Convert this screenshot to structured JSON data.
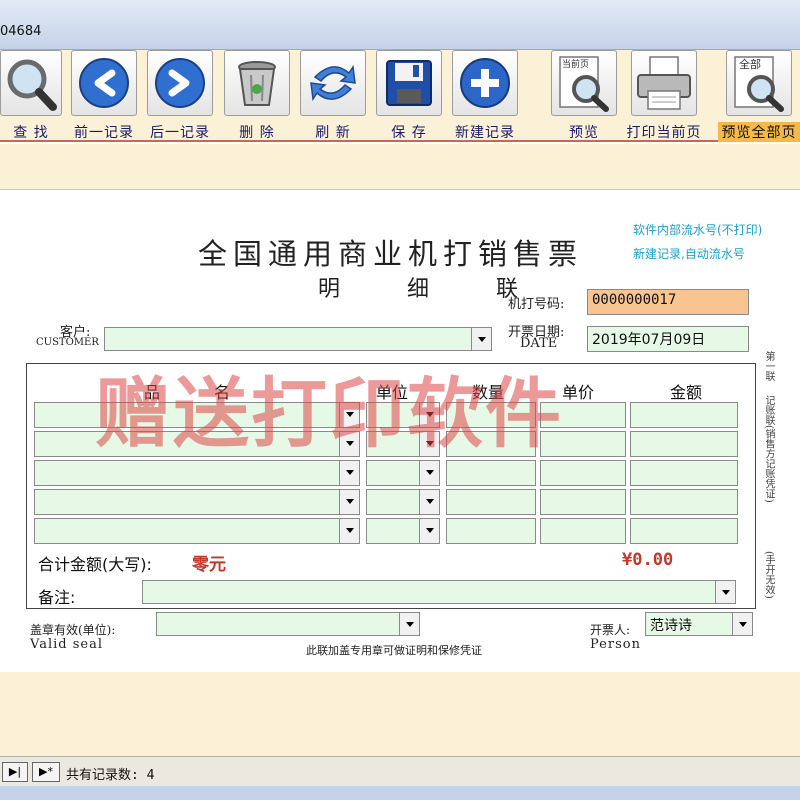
{
  "window": {
    "title_fragment": "04684"
  },
  "toolbar": {
    "buttons": [
      {
        "label": "查 找",
        "icon": "magnifier-icon"
      },
      {
        "label": "前一记录",
        "icon": "arrow-left-icon"
      },
      {
        "label": "后一记录",
        "icon": "arrow-right-icon"
      },
      {
        "label": "删 除",
        "icon": "trash-icon"
      },
      {
        "label": "刷 新",
        "icon": "refresh-icon"
      },
      {
        "label": "保 存",
        "icon": "floppy-save-icon"
      },
      {
        "label": "新建记录",
        "icon": "plus-icon"
      },
      {
        "label": "预览",
        "icon": "preview-page-icon",
        "icon_text": "当前页"
      },
      {
        "label": "打印当前页",
        "icon": "printer-icon"
      },
      {
        "label": "预览全部页",
        "icon": "preview-all-icon",
        "icon_text": "全部",
        "active": true
      }
    ]
  },
  "invoice": {
    "title": "全国通用商业机打销售票",
    "subtitle": "明 细 联",
    "note_line1": "软件内部流水号(不打印)",
    "note_line2": "新建记录,自动流水号",
    "machine_no_label": "机打号码:",
    "machine_no": "0000000017",
    "customer_label": "客户:",
    "customer_label_en": "CUSTOMER",
    "customer_value": "",
    "date_label": "开票日期:",
    "date_label_en": "DATE",
    "date_value": "2019年07月09日",
    "columns": [
      "品",
      "名",
      "单位",
      "数量",
      "单价",
      "金额"
    ],
    "total_label": "合计金额(大写):",
    "total_words": "零元",
    "total_amount": "¥0.00",
    "remark_label": "备注:",
    "seal_label": "盖章有效(单位):",
    "seal_label_en": "Valid seal",
    "seal_note": "此联加盖专用章可做证明和保修凭证",
    "issuer_label": "开票人:",
    "issuer_label_en": "Person",
    "issuer_value": "范诗诗",
    "side_text_1": "第一联",
    "side_text_2": "记账联(销售方记账凭证)",
    "side_text_3": "(手开无效)"
  },
  "watermark": "赠送打印软件",
  "status": {
    "record_count": "共有记录数: 4"
  },
  "colors": {
    "toolbar_bg": "#fbf1d6",
    "field_green": "#e6f8e6",
    "field_orange": "#f8c592",
    "accent_red": "#c0392b",
    "note_blue": "#1da0c8"
  }
}
